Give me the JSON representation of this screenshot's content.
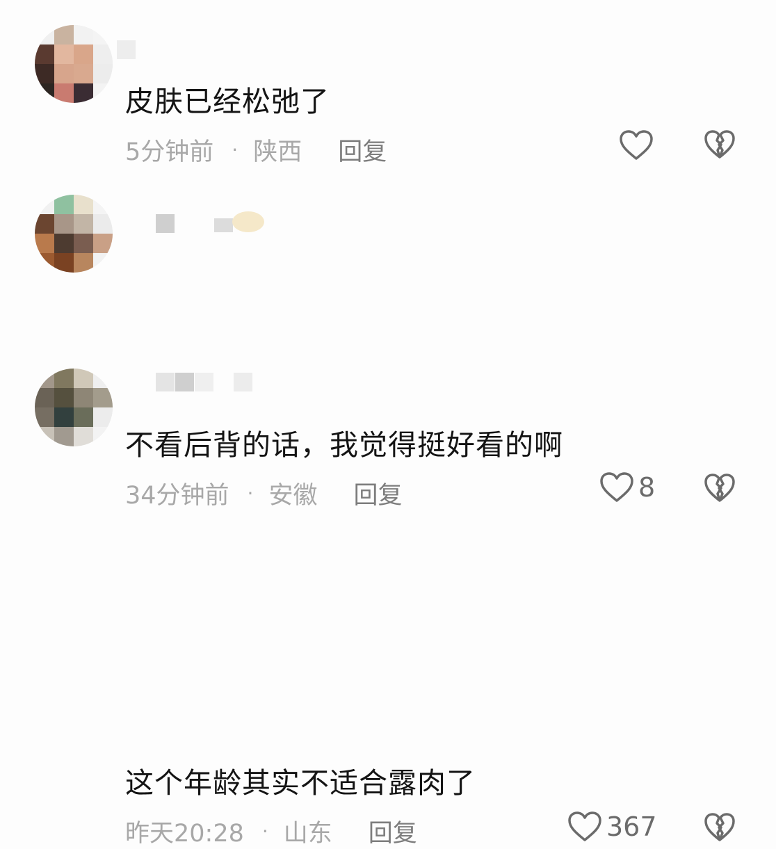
{
  "comments": [
    {
      "text": "皮肤已经松弛了",
      "time": "5分钟前",
      "location": "陕西",
      "reply_label": "回复",
      "like_count": ""
    },
    {
      "text": "不看后背的话，我觉得挺好看的啊",
      "time": "34分钟前",
      "location": "安徽",
      "reply_label": "回复",
      "like_count": "8"
    },
    {
      "text": "这个年龄其实不适合露肉了",
      "time": "昨天20:28",
      "location": "山东",
      "reply_label": "回复",
      "like_count": "367"
    }
  ],
  "separator": "·",
  "icons": {
    "like": "heart-outline-icon",
    "dislike": "broken-heart-icon"
  },
  "colors": {
    "text": "#141414",
    "meta": "#a8a8a8",
    "reply": "#7d7d7d",
    "icon": "#6b6b6b"
  }
}
